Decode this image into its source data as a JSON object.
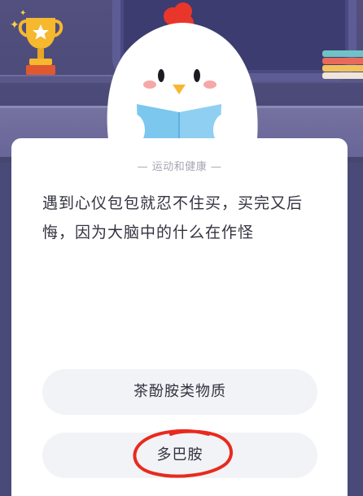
{
  "quiz": {
    "category": "— 运动和健康 —",
    "question": "遇到心仪包包就忍不住买，买完又后悔，因为大脑中的什么在作怪",
    "options": [
      {
        "label": "茶酚胺类物质"
      },
      {
        "label": "多巴胺"
      }
    ]
  },
  "colors": {
    "background": "#4a4a78",
    "card": "#ffffff",
    "option_bg": "#f2f3f6",
    "annotation_circle": "#e82a1e",
    "trophy": "#f5b82e"
  },
  "icons": {
    "trophy": "trophy-icon",
    "mascot": "chicken-mascot",
    "books": "books-icon"
  }
}
